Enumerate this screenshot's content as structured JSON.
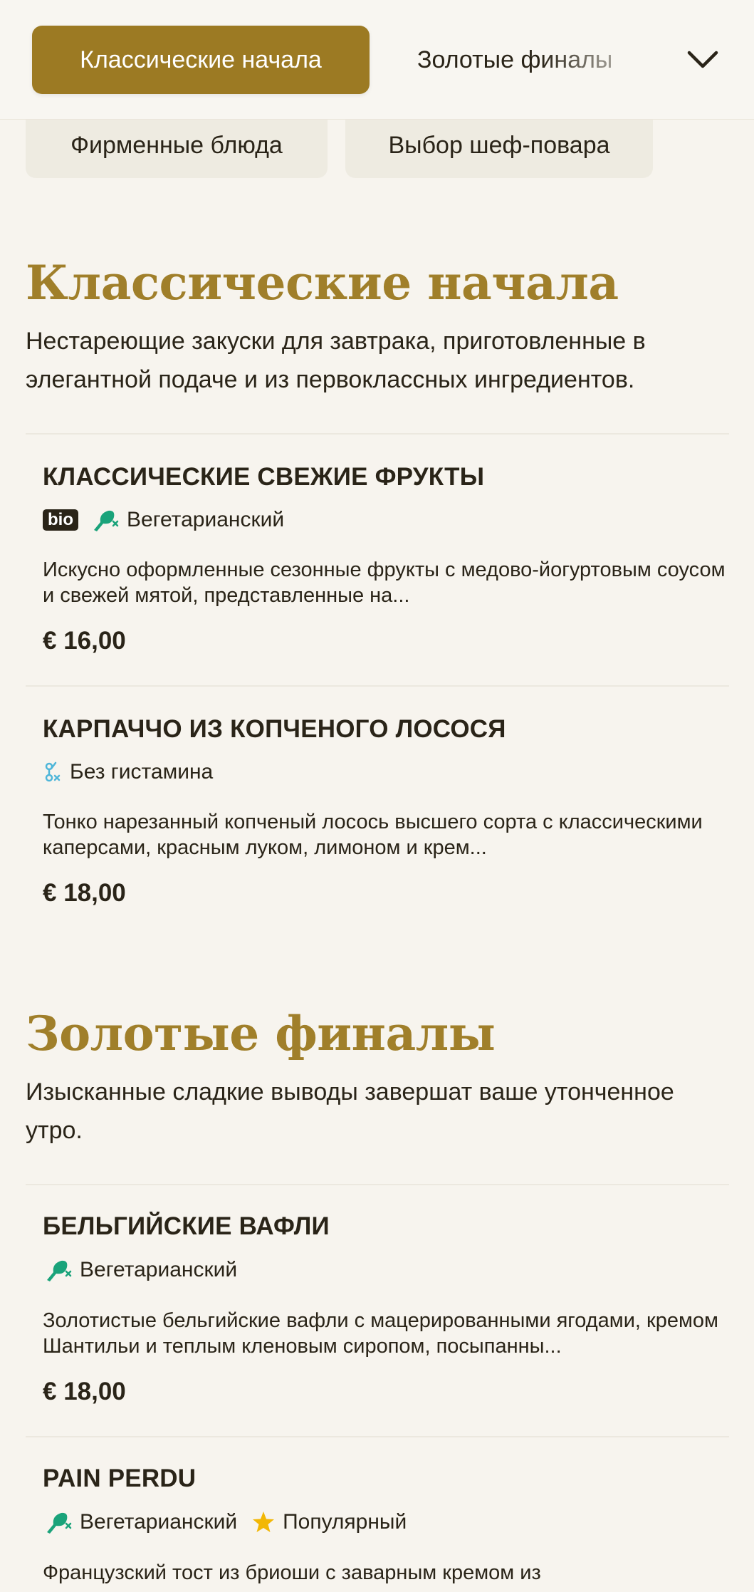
{
  "category_nav": {
    "active_tab": "Классические начала",
    "next_tab": "Золотые финалы",
    "more_tabs": [
      "Фирменные блюда",
      "Выбор шеф-повара"
    ]
  },
  "sections": [
    {
      "title": "Классические начала",
      "description": "Нестареющие закуски для завтрака, приготовленные в элегантной подаче и из первоклассных ингредиентов.",
      "items": [
        {
          "name": "КЛАССИЧЕСКИЕ СВЕЖИЕ ФРУКТЫ",
          "badge": "bio",
          "tags": [
            {
              "icon": "vegetarian-icon",
              "label": "Вегетарианский"
            }
          ],
          "description": "Искусно оформленные сезонные фрукты с медово-йогуртовым соусом и свежей мятой, представленные на...",
          "price": "€ 16,00"
        },
        {
          "name": "КАРПАЧЧО ИЗ КОПЧЕНОГО ЛОСОСЯ",
          "tags": [
            {
              "icon": "histamine-free-icon",
              "label": "Без гистамина"
            }
          ],
          "description": "Тонко нарезанный копченый лосось высшего сорта с классическими каперсами, красным луком, лимоном и крем...",
          "price": "€ 18,00"
        }
      ]
    },
    {
      "title": "Золотые финалы",
      "description": "Изысканные сладкие выводы завершат ваше утонченное утро.",
      "items": [
        {
          "name": "БЕЛЬГИЙСКИЕ ВАФЛИ",
          "tags": [
            {
              "icon": "vegetarian-icon",
              "label": "Вегетарианский"
            }
          ],
          "description": "Золотистые бельгийские вафли с мацерированными ягодами, кремом Шантильи и теплым кленовым сиропом, посыпанны...",
          "price": "€ 18,00"
        },
        {
          "name": "PAIN PERDU",
          "tags": [
            {
              "icon": "vegetarian-icon",
              "label": "Вегетарианский"
            },
            {
              "icon": "star-icon",
              "label": "Популярный"
            }
          ],
          "description": "Французский тост из бриоши с заварным кремом из"
        }
      ]
    }
  ],
  "colors": {
    "accent": "#9c7a23",
    "section_title": "#a07f2a",
    "vegetarian": "#1aa37a",
    "histamine": "#4fb6d9",
    "star": "#f2b705",
    "background": "#f7f4ee"
  }
}
